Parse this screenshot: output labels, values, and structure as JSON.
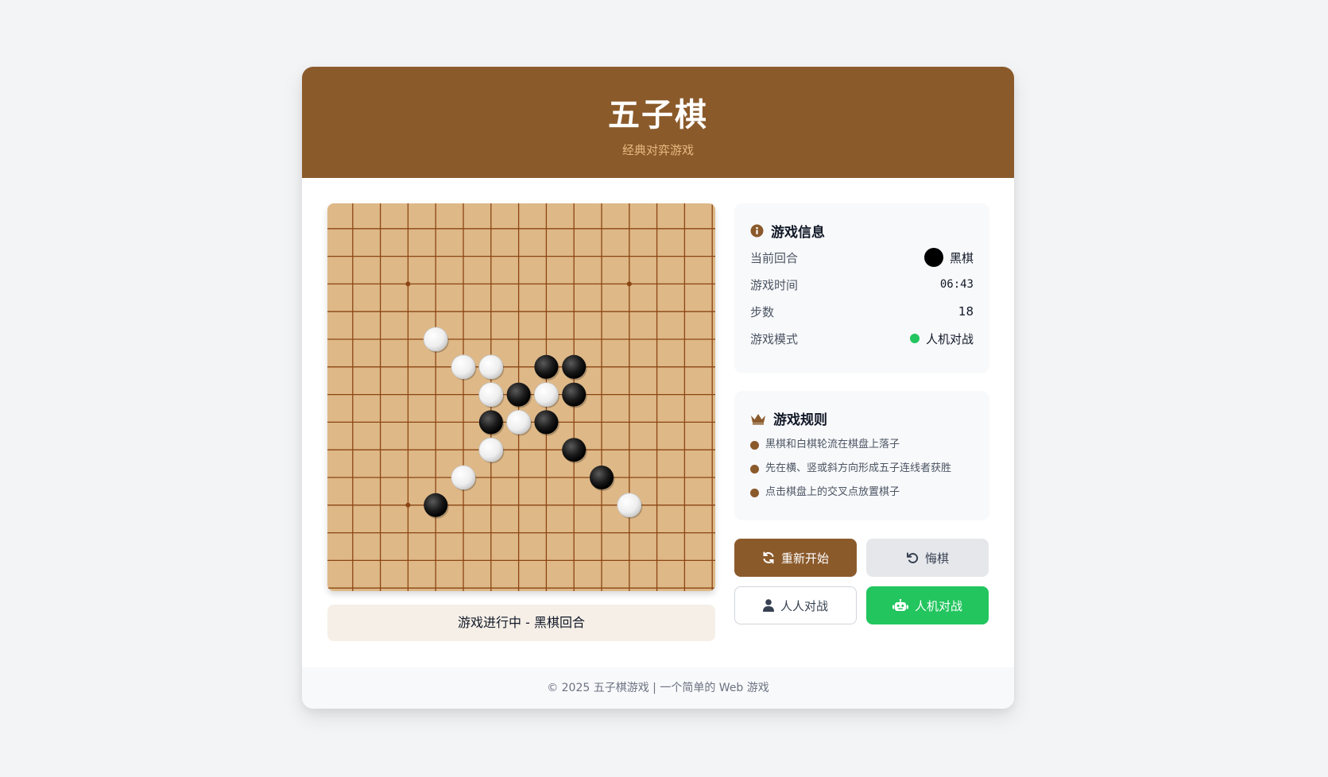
{
  "header": {
    "title": "五子棋",
    "subtitle": "经典对弈游戏"
  },
  "board": {
    "size": 15,
    "star_points": [
      [
        3,
        3
      ],
      [
        3,
        11
      ],
      [
        11,
        3
      ],
      [
        11,
        11
      ]
    ],
    "stones": [
      {
        "row": 5,
        "col": 4,
        "color": "white"
      },
      {
        "row": 6,
        "col": 5,
        "color": "white"
      },
      {
        "row": 6,
        "col": 6,
        "color": "white"
      },
      {
        "row": 6,
        "col": 8,
        "color": "black"
      },
      {
        "row": 6,
        "col": 9,
        "color": "black"
      },
      {
        "row": 7,
        "col": 6,
        "color": "white"
      },
      {
        "row": 7,
        "col": 7,
        "color": "black"
      },
      {
        "row": 7,
        "col": 8,
        "color": "white"
      },
      {
        "row": 7,
        "col": 9,
        "color": "black"
      },
      {
        "row": 8,
        "col": 6,
        "color": "black"
      },
      {
        "row": 8,
        "col": 7,
        "color": "white"
      },
      {
        "row": 8,
        "col": 8,
        "color": "black"
      },
      {
        "row": 9,
        "col": 6,
        "color": "white"
      },
      {
        "row": 9,
        "col": 9,
        "color": "black"
      },
      {
        "row": 10,
        "col": 5,
        "color": "white"
      },
      {
        "row": 10,
        "col": 10,
        "color": "black"
      },
      {
        "row": 11,
        "col": 4,
        "color": "black"
      },
      {
        "row": 11,
        "col": 11,
        "color": "white"
      }
    ]
  },
  "status": "游戏进行中 - 黑棋回合",
  "info": {
    "title": "游戏信息",
    "icon": "info-circle-icon",
    "turn_label": "当前回合",
    "turn_value": "黑棋",
    "time_label": "游戏时间",
    "time_value": "06:43",
    "steps_label": "步数",
    "steps_value": "18",
    "mode_label": "游戏模式",
    "mode_value": "人机对战"
  },
  "rules": {
    "title": "游戏规则",
    "icon": "crown-icon",
    "items": [
      "黑棋和白棋轮流在棋盘上落子",
      "先在横、竖或斜方向形成五子连线者获胜",
      "点击棋盘上的交叉点放置棋子"
    ]
  },
  "buttons": {
    "restart": "重新开始",
    "undo": "悔棋",
    "pvp": "人人对战",
    "pve": "人机对战"
  },
  "footer": "© 2025 五子棋游戏 | 一个简单的 Web 游戏",
  "colors": {
    "brand": "#8b5a2b",
    "board": "#deb887",
    "active_mode": "#22c55e"
  }
}
